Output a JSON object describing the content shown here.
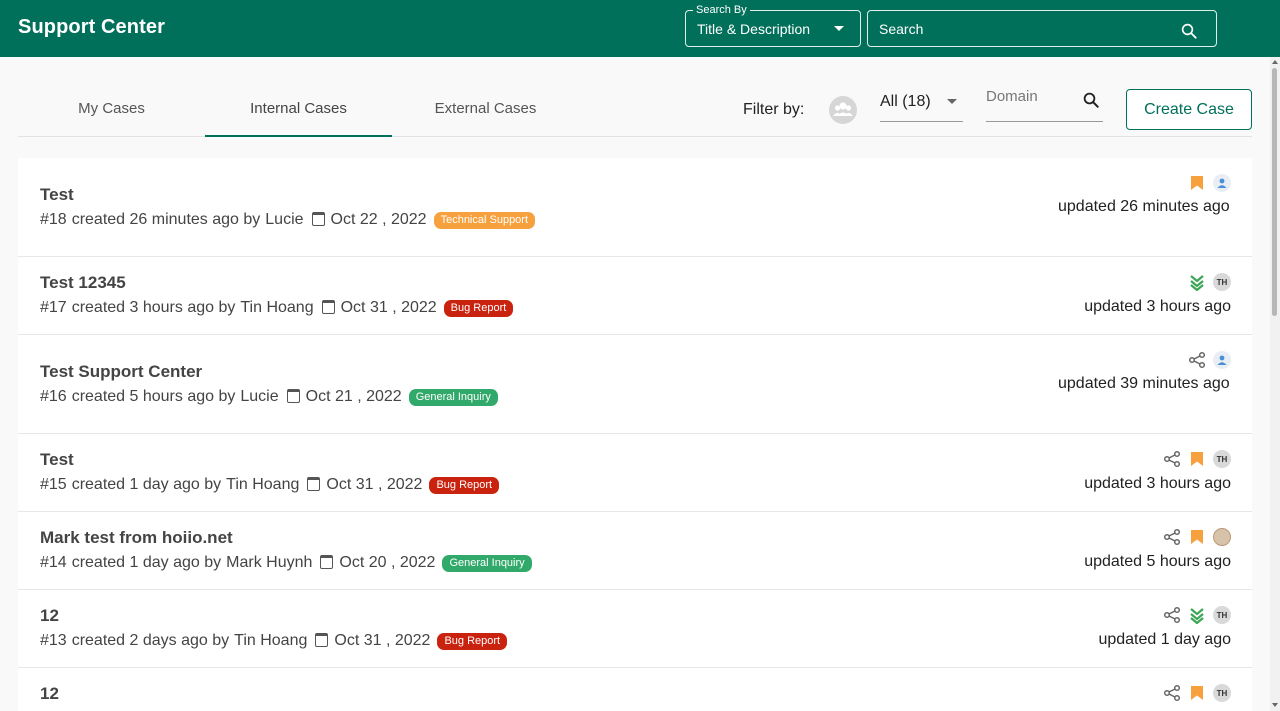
{
  "header": {
    "title": "Support Center",
    "search_by_label": "Search By",
    "search_by_value": "Title & Description",
    "search_placeholder": "Search"
  },
  "tabs": [
    {
      "label": "My Cases"
    },
    {
      "label": "Internal Cases"
    },
    {
      "label": "External Cases"
    }
  ],
  "filters": {
    "label": "Filter by:",
    "selected": "All (18)",
    "domain_placeholder": "Domain"
  },
  "actions": {
    "create_case": "Create Case"
  },
  "colors": {
    "brand": "#00705a",
    "technical_support": "#f6a13d",
    "bug_report": "#c9220e",
    "general_inquiry": "#31a96a"
  },
  "cases": [
    {
      "title": "Test",
      "number": "#18",
      "created": "created 26 minutes ago by",
      "author": "Lucie",
      "date": "Oct 22 , 2022",
      "category": "Technical Support",
      "category_color": "#f6a13d",
      "updated": "updated 26 minutes ago",
      "icons": [
        "bookmark-icon",
        "user-avatar"
      ]
    },
    {
      "title": "Test 12345",
      "number": "#17",
      "created": "created 3 hours ago by",
      "author": "Tin Hoang",
      "date": "Oct 31 , 2022",
      "category": "Bug Report",
      "category_color": "#c9220e",
      "updated": "updated 3 hours ago",
      "icons": [
        "priority-low-icon",
        "th-avatar"
      ]
    },
    {
      "title": "Test Support Center",
      "number": "#16",
      "created": "created 5 hours ago by",
      "author": "Lucie",
      "date": "Oct 21 , 2022",
      "category": "General Inquiry",
      "category_color": "#31a96a",
      "updated": "updated 39 minutes ago",
      "icons": [
        "share-icon",
        "user-avatar"
      ]
    },
    {
      "title": "Test",
      "number": "#15",
      "created": "created 1 day ago by",
      "author": "Tin Hoang",
      "date": "Oct 31 , 2022",
      "category": "Bug Report",
      "category_color": "#c9220e",
      "updated": "updated 3 hours ago",
      "icons": [
        "share-icon",
        "bookmark-icon",
        "th-avatar"
      ]
    },
    {
      "title": "Mark test from hoiio.net",
      "number": "#14",
      "created": "created 1 day ago by",
      "author": "Mark Huynh",
      "date": "Oct 20 , 2022",
      "category": "General Inquiry",
      "category_color": "#31a96a",
      "updated": "updated 5 hours ago",
      "icons": [
        "share-icon",
        "bookmark-icon",
        "photo-avatar"
      ]
    },
    {
      "title": "12",
      "number": "#13",
      "created": "created 2 days ago by",
      "author": "Tin Hoang",
      "date": "Oct 31 , 2022",
      "category": "Bug Report",
      "category_color": "#c9220e",
      "updated": "updated 1 day ago",
      "icons": [
        "share-icon",
        "priority-low-icon",
        "th-avatar"
      ]
    },
    {
      "title": "12",
      "icons": [
        "share-icon",
        "bookmark-icon",
        "th-avatar"
      ]
    }
  ],
  "avatar_initials": "TH"
}
